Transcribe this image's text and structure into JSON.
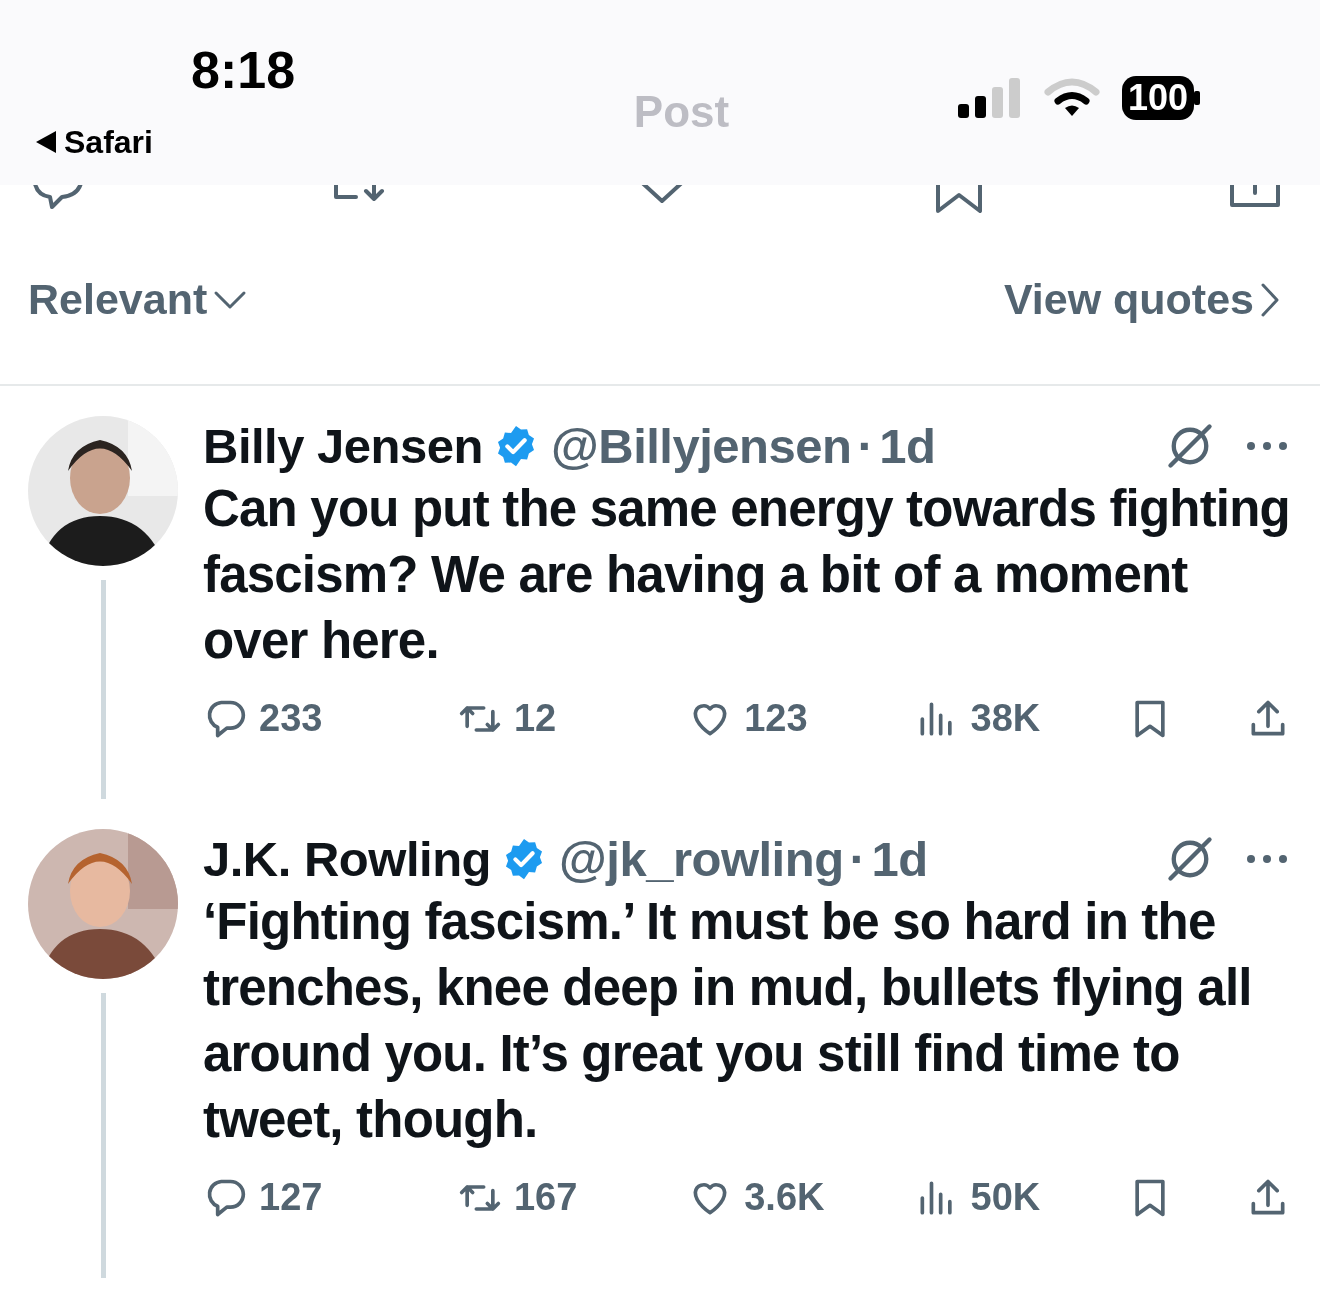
{
  "status_bar": {
    "time": "8:18",
    "back_label": "Safari",
    "battery": "100"
  },
  "header": {
    "title": "Post"
  },
  "sort": {
    "label": "Relevant",
    "link": "View quotes"
  },
  "replies": [
    {
      "name": "Billy Jensen",
      "verified": true,
      "handle": "@Billyjensen",
      "separator": "·",
      "age": "1d",
      "text": "Can you put the same energy towards fighting fascism? We are having a bit of a moment over here.",
      "stats": {
        "replies": "233",
        "reposts": "12",
        "likes": "123",
        "views": "38K"
      }
    },
    {
      "name": "J.K. Rowling",
      "verified": true,
      "handle": "@jk_rowling",
      "separator": "·",
      "age": "1d",
      "text": "‘Fighting fascism.’ It must be so hard in the trenches, knee deep in mud, bullets flying all around you. It’s great you still find time to tweet, though.",
      "stats": {
        "replies": "127",
        "reposts": "167",
        "likes": "3.6K",
        "views": "50K"
      }
    }
  ]
}
